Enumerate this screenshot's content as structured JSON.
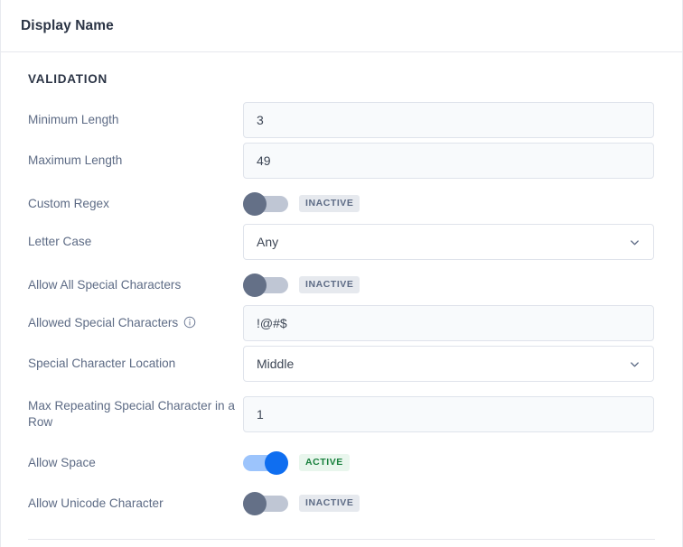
{
  "header": {
    "title": "Display Name"
  },
  "section": {
    "heading": "VALIDATION"
  },
  "fields": {
    "minimum_length": {
      "label": "Minimum Length",
      "value": "3",
      "placeholder": ""
    },
    "maximum_length": {
      "label": "Maximum Length",
      "value": "49",
      "placeholder": ""
    },
    "custom_regex": {
      "label": "Custom Regex",
      "state_label": "INACTIVE",
      "enabled": false
    },
    "letter_case": {
      "label": "Letter Case",
      "value": "Any",
      "options": [
        "Any"
      ]
    },
    "allow_all_special_characters": {
      "label": "Allow All Special Characters",
      "state_label": "INACTIVE",
      "enabled": false
    },
    "allowed_special_characters": {
      "label": "Allowed Special Characters",
      "info_icon": "info-icon",
      "value": "!@#$",
      "placeholder": ""
    },
    "special_character_location": {
      "label": "Special Character Location",
      "value": "Middle",
      "options": [
        "Middle"
      ]
    },
    "max_repeating_special_character": {
      "label": "Max Repeating Special Character in a Row",
      "value": "1",
      "placeholder": ""
    },
    "allow_space": {
      "label": "Allow Space",
      "state_label": "ACTIVE",
      "enabled": true
    },
    "allow_unicode_character": {
      "label": "Allow Unicode Character",
      "state_label": "INACTIVE",
      "enabled": false
    }
  },
  "icons": {
    "chevron": "chevron-down-icon",
    "info": "info-icon"
  },
  "colors": {
    "accent_blue": "#0f6ef0",
    "toggle_on_track": "#9cc4fc",
    "toggle_off_knob": "#647087",
    "toggle_off_track": "#bfc6d4",
    "active_badge_text": "#18803c",
    "active_badge_bg": "#e9f6ed",
    "inactive_badge_text": "#5d6b85",
    "inactive_badge_bg": "#e6e9ee",
    "label_text": "#5d6b85",
    "heading_text": "#2b3445",
    "input_bg": "#f8fafc",
    "border": "#dfe3eb"
  }
}
